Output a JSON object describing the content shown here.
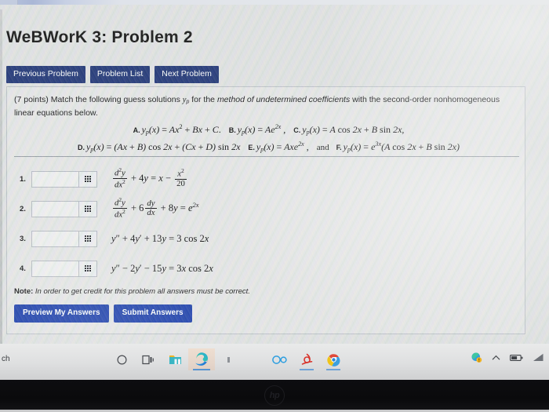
{
  "browser": {
    "tab_strip_visible": true
  },
  "page": {
    "title": "WeBWorK 3: Problem 2",
    "nav_buttons": [
      {
        "label": "Previous Problem",
        "name": "previous-problem-button"
      },
      {
        "label": "Problem List",
        "name": "problem-list-button"
      },
      {
        "label": "Next Problem",
        "name": "next-problem-button"
      }
    ],
    "statement": {
      "points": "(7 points)",
      "text_1": " Match the following guess solutions ",
      "yp": "y",
      "yp_sub": "p",
      "text_2": " for the ",
      "italic_phrase": "method of undetermined coefficients",
      "text_3": " with the second-order nonhomogeneous linear equations below."
    },
    "choices": [
      {
        "label": "A.",
        "math": "y_p(x) = Ax^2 + Bx + C.",
        "name": "choice-a"
      },
      {
        "label": "B.",
        "math": "y_p(x) = Ae^{2x} ,",
        "name": "choice-b"
      },
      {
        "label": "C.",
        "math": "y_p(x) = A cos 2x + B sin 2x,",
        "name": "choice-c"
      },
      {
        "label": "D.",
        "math": "y_p(x) = (Ax + B) cos 2x + (Cx + D) sin 2x",
        "name": "choice-d"
      },
      {
        "label": "E.",
        "math": "y_p(x) = Axe^{2x} ,",
        "name": "choice-e"
      },
      {
        "label": "F.",
        "math": "y_p(x) = e^{3x}(A cos 2x + B sin 2x)",
        "name": "choice-f",
        "prefix": "and"
      }
    ],
    "equations": [
      {
        "number": "1.",
        "answer_value": "",
        "equation": "d^2y/dx^2 + 4y = x - x^2/20"
      },
      {
        "number": "2.",
        "answer_value": "",
        "equation": "d^2y/dx^2 + 6 dy/dx + 8y = e^{2x}"
      },
      {
        "number": "3.",
        "answer_value": "",
        "equation": "y'' + 4y' + 13y = 3 cos 2x"
      },
      {
        "number": "4.",
        "answer_value": "",
        "equation": "y'' - 2y' - 15y = 3x cos 2x"
      }
    ],
    "note": {
      "prefix": "Note:",
      "text": "In order to get credit for this problem all answers must be correct."
    },
    "action_buttons": [
      {
        "label": "Preview My Answers",
        "name": "preview-my-answers-button"
      },
      {
        "label": "Submit Answers",
        "name": "submit-answers-button"
      }
    ]
  },
  "taskbar": {
    "search_tail_text": "ch",
    "icons": [
      {
        "name": "cortana-icon",
        "glyph": "circle"
      },
      {
        "name": "task-view-icon",
        "glyph": "taskview"
      },
      {
        "name": "file-explorer-icon",
        "glyph": "folder"
      },
      {
        "name": "microsoft-edge-icon",
        "glyph": "edge"
      },
      {
        "name": "unknown-app-icon",
        "glyph": "small"
      },
      {
        "name": "office-icon",
        "glyph": "infinity"
      },
      {
        "name": "adobe-acrobat-icon",
        "glyph": "swirl"
      },
      {
        "name": "chrome-icon",
        "glyph": "chrome"
      }
    ],
    "tray": [
      {
        "name": "notification-status-icon"
      },
      {
        "name": "show-hidden-icons-chevron"
      },
      {
        "name": "battery-icon"
      },
      {
        "name": "wifi-icon"
      }
    ]
  },
  "bezel": {
    "brand": "hp"
  },
  "colors": {
    "nav_button_bg": "#253a7a",
    "action_button_bg": "#1e41ae",
    "page_bg": "#e3e4e5",
    "taskbar_bg": "#e3e4e5",
    "bezel": "#0a0a0c"
  }
}
